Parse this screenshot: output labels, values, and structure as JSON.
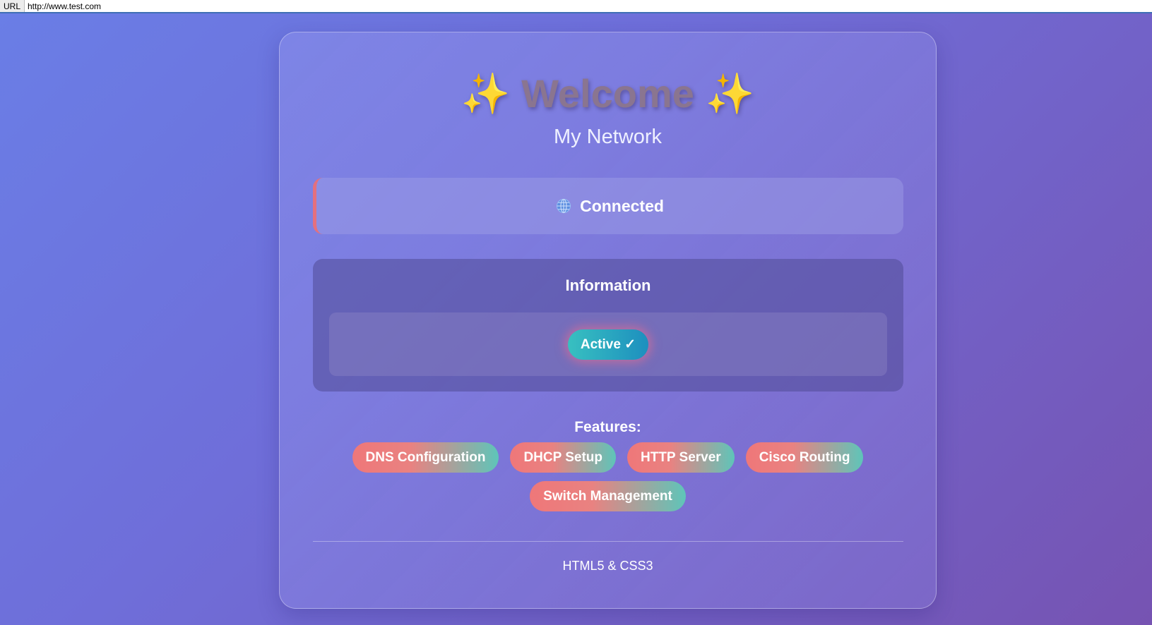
{
  "browser": {
    "url_label": "URL",
    "url_value": "http://www.test.com"
  },
  "header": {
    "sparkle_left": "✨",
    "title": "Welcome",
    "sparkle_right": "✨",
    "subtitle": "My Network"
  },
  "status": {
    "icon": "globe-icon",
    "text": "Connected"
  },
  "information": {
    "title": "Information",
    "badge": "Active ✓"
  },
  "features": {
    "label": "Features:",
    "items": [
      "DNS Configuration",
      "DHCP Setup",
      "HTTP Server",
      "Cisco Routing",
      "Switch Management"
    ]
  },
  "footer": {
    "text": "HTML5 & CSS3"
  },
  "colors": {
    "status_accent": "#e4707e",
    "badge_start": "#38c0c0",
    "badge_end": "#1d8fbf",
    "pill_start": "#ef7779",
    "pill_end": "#5ec5b9"
  }
}
